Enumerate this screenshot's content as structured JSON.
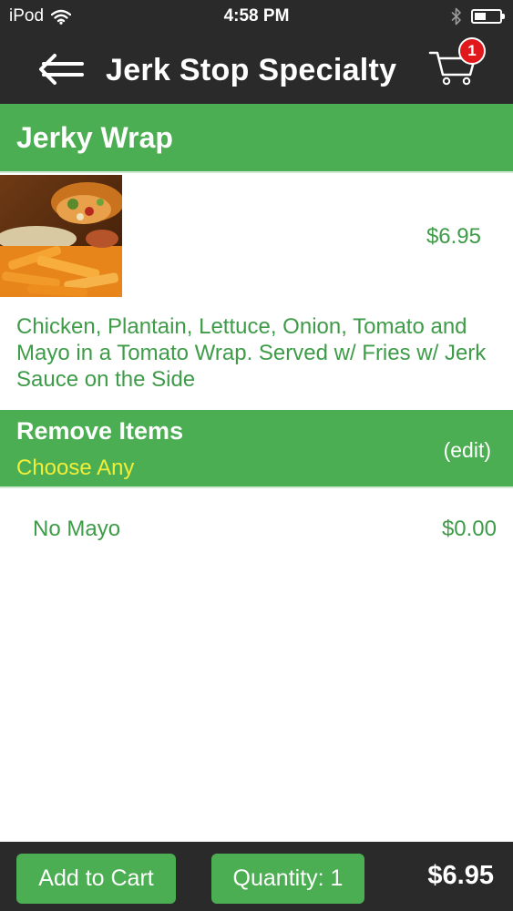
{
  "status_bar": {
    "carrier": "iPod",
    "time": "4:58 PM",
    "icons": [
      "wifi-icon",
      "bluetooth-icon",
      "battery-icon"
    ]
  },
  "nav": {
    "title": "Jerk Stop Specialty",
    "back_icon": "back-arrow-icon",
    "cart_icon": "shopping-cart-icon",
    "cart_count": "1"
  },
  "item": {
    "name": "Jerky Wrap",
    "price": "$6.95",
    "description": "Chicken, Plantain, Lettuce, Onion, Tomato and Mayo in a Tomato Wrap. Served w/ Fries w/ Jerk Sauce on the Side"
  },
  "remove_section": {
    "title": "Remove Items",
    "subtitle": "Choose Any",
    "edit_label": "(edit)",
    "options": [
      {
        "name": "No Mayo",
        "price": "$0.00"
      }
    ]
  },
  "footer": {
    "add_to_cart_label": "Add to Cart",
    "quantity_label": "Quantity: 1",
    "total": "$6.95"
  },
  "colors": {
    "dark_bar": "#2a2a2a",
    "accent_green": "#4cae52",
    "text_green": "#3e9b48",
    "subtitle_yellow": "#f1ee3a",
    "badge_red": "#e0171b"
  }
}
